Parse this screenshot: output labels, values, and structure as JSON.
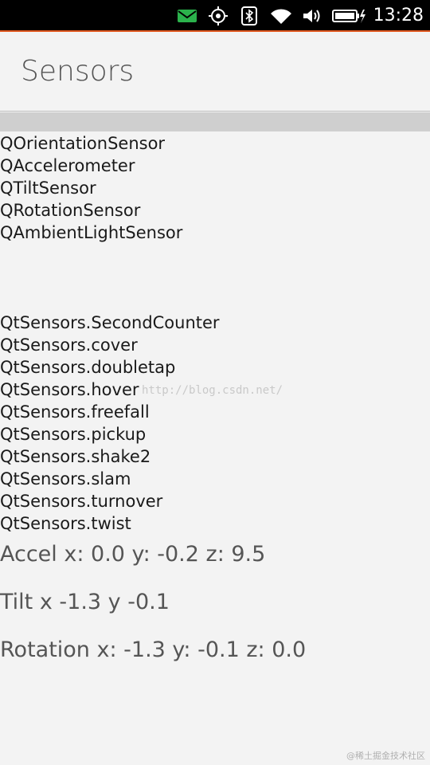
{
  "status_bar": {
    "time": "13:28",
    "icons": [
      "message-icon",
      "gps-icon",
      "bluetooth-icon",
      "wifi-icon",
      "volume-icon",
      "battery-charging-icon"
    ]
  },
  "header": {
    "title": "Sensors"
  },
  "sensor_list": [
    "QOrientationSensor",
    "QAccelerometer",
    "QTiltSensor",
    "QRotationSensor",
    "QAmbientLightSensor"
  ],
  "gesture_list": [
    "QtSensors.SecondCounter",
    "QtSensors.cover",
    "QtSensors.doubletap",
    "QtSensors.hover",
    "QtSensors.freefall",
    "QtSensors.pickup",
    "QtSensors.shake2",
    "QtSensors.slam",
    "QtSensors.turnover",
    "QtSensors.twist"
  ],
  "readings": {
    "accel": "Accel x: 0.0 y: -0.2 z: 9.5",
    "tilt": "Tilt x -1.3 y -0.1",
    "rotation": "Rotation x: -1.3 y: -0.1 z: 0.0"
  },
  "watermark": "http://blog.csdn.net/",
  "corner_mark": "@稀土掘金技术社区",
  "colors": {
    "status_bar_bg": "#000000",
    "accent_line": "#e0561e",
    "message_icon": "#2bb24c",
    "background": "#f3f3f3",
    "divider_band": "#cfcfcf"
  }
}
